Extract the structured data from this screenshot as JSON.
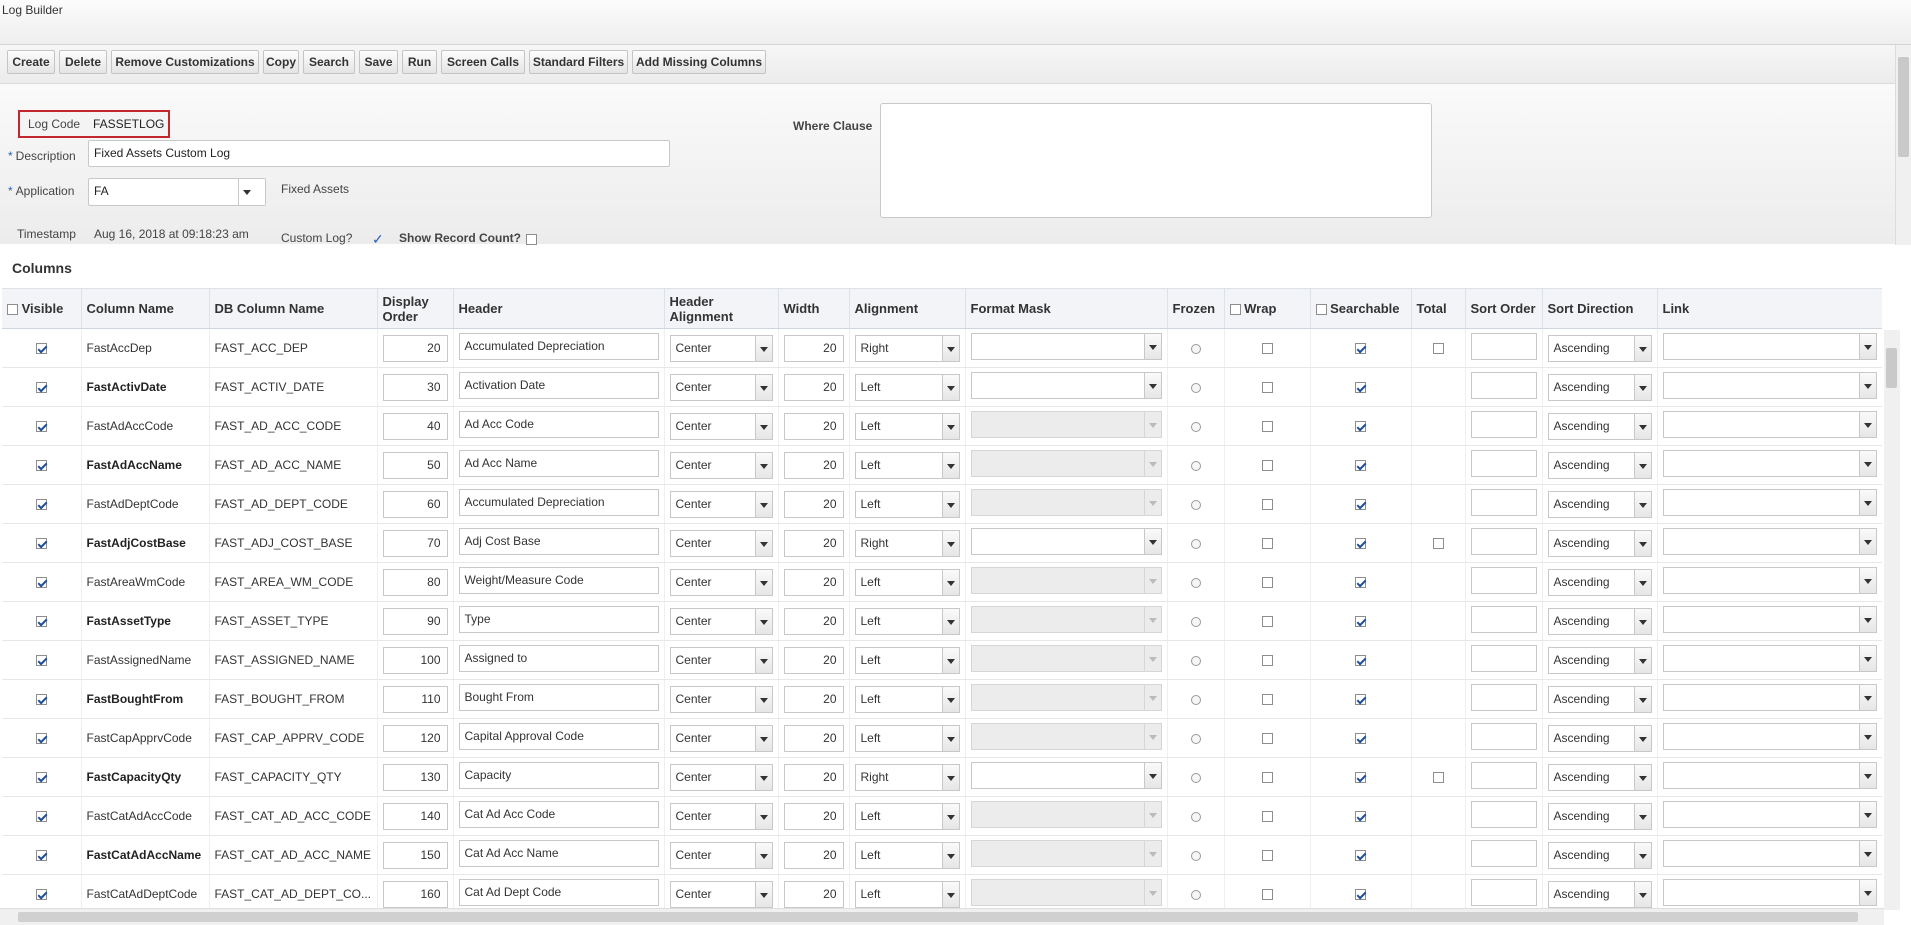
{
  "window": {
    "title": "Log Builder"
  },
  "toolbar": {
    "buttons": [
      "Create",
      "Delete",
      "Remove Customizations",
      "Copy",
      "Search",
      "Save",
      "Run",
      "Screen Calls",
      "Standard Filters",
      "Add Missing Columns"
    ]
  },
  "form": {
    "log_code_label": "Log Code",
    "log_code_value": "FASSETLOG",
    "description_label": "Description",
    "description_value": "Fixed Assets Custom Log",
    "application_label": "Application",
    "application_value": "FA",
    "application_name": "Fixed Assets",
    "timestamp_label": "Timestamp",
    "timestamp_value": "Aug 16, 2018 at 09:18:23 am",
    "custom_log_label": "Custom Log?",
    "custom_log_checked": true,
    "show_record_count_label": "Show Record Count?",
    "show_record_count_checked": false,
    "where_clause_label": "Where Clause",
    "where_clause_value": "",
    "required_marker": "*"
  },
  "columns_section": {
    "title": "Columns"
  },
  "table": {
    "headers": {
      "visible": "Visible",
      "column_name": "Column Name",
      "db_column_name": "DB Column Name",
      "display_order": "Display Order",
      "header": "Header",
      "header_alignment": "Header Alignment",
      "width": "Width",
      "alignment": "Alignment",
      "format_mask": "Format Mask",
      "frozen": "Frozen",
      "wrap": "Wrap",
      "searchable": "Searchable",
      "total": "Total",
      "sort_order": "Sort Order",
      "sort_direction": "Sort Direction",
      "link": "Link"
    },
    "rows": [
      {
        "column_name": "FastAccDep",
        "db_column_name": "FAST_ACC_DEP",
        "display_order": "20",
        "header": "Accumulated Depreciation",
        "header_alignment": "Center",
        "width": "20",
        "alignment": "Right",
        "format_mask_enabled": true,
        "total_visible": true,
        "sort_direction": "Ascending"
      },
      {
        "column_name": "FastActivDate",
        "db_column_name": "FAST_ACTIV_DATE",
        "display_order": "30",
        "header": "Activation Date",
        "header_alignment": "Center",
        "width": "20",
        "alignment": "Left",
        "format_mask_enabled": true,
        "total_visible": false,
        "sort_direction": "Ascending"
      },
      {
        "column_name": "FastAdAccCode",
        "db_column_name": "FAST_AD_ACC_CODE",
        "display_order": "40",
        "header": "Ad Acc Code",
        "header_alignment": "Center",
        "width": "20",
        "alignment": "Left",
        "format_mask_enabled": false,
        "total_visible": false,
        "sort_direction": "Ascending"
      },
      {
        "column_name": "FastAdAccName",
        "db_column_name": "FAST_AD_ACC_NAME",
        "display_order": "50",
        "header": "Ad Acc Name",
        "header_alignment": "Center",
        "width": "20",
        "alignment": "Left",
        "format_mask_enabled": false,
        "total_visible": false,
        "sort_direction": "Ascending"
      },
      {
        "column_name": "FastAdDeptCode",
        "db_column_name": "FAST_AD_DEPT_CODE",
        "display_order": "60",
        "header": "Accumulated Depreciation",
        "header_alignment": "Center",
        "width": "20",
        "alignment": "Left",
        "format_mask_enabled": false,
        "total_visible": false,
        "sort_direction": "Ascending"
      },
      {
        "column_name": "FastAdjCostBase",
        "db_column_name": "FAST_ADJ_COST_BASE",
        "display_order": "70",
        "header": "Adj Cost Base",
        "header_alignment": "Center",
        "width": "20",
        "alignment": "Right",
        "format_mask_enabled": true,
        "total_visible": true,
        "sort_direction": "Ascending"
      },
      {
        "column_name": "FastAreaWmCode",
        "db_column_name": "FAST_AREA_WM_CODE",
        "display_order": "80",
        "header": "Weight/Measure Code",
        "header_alignment": "Center",
        "width": "20",
        "alignment": "Left",
        "format_mask_enabled": false,
        "total_visible": false,
        "sort_direction": "Ascending"
      },
      {
        "column_name": "FastAssetType",
        "db_column_name": "FAST_ASSET_TYPE",
        "display_order": "90",
        "header": "Type",
        "header_alignment": "Center",
        "width": "20",
        "alignment": "Left",
        "format_mask_enabled": false,
        "total_visible": false,
        "sort_direction": "Ascending"
      },
      {
        "column_name": "FastAssignedName",
        "db_column_name": "FAST_ASSIGNED_NAME",
        "display_order": "100",
        "header": "Assigned to",
        "header_alignment": "Center",
        "width": "20",
        "alignment": "Left",
        "format_mask_enabled": false,
        "total_visible": false,
        "sort_direction": "Ascending"
      },
      {
        "column_name": "FastBoughtFrom",
        "db_column_name": "FAST_BOUGHT_FROM",
        "display_order": "110",
        "header": "Bought From",
        "header_alignment": "Center",
        "width": "20",
        "alignment": "Left",
        "format_mask_enabled": false,
        "total_visible": false,
        "sort_direction": "Ascending"
      },
      {
        "column_name": "FastCapApprvCode",
        "db_column_name": "FAST_CAP_APPRV_CODE",
        "display_order": "120",
        "header": "Capital Approval Code",
        "header_alignment": "Center",
        "width": "20",
        "alignment": "Left",
        "format_mask_enabled": false,
        "total_visible": false,
        "sort_direction": "Ascending"
      },
      {
        "column_name": "FastCapacityQty",
        "db_column_name": "FAST_CAPACITY_QTY",
        "display_order": "130",
        "header": "Capacity",
        "header_alignment": "Center",
        "width": "20",
        "alignment": "Right",
        "format_mask_enabled": true,
        "total_visible": true,
        "sort_direction": "Ascending"
      },
      {
        "column_name": "FastCatAdAccCode",
        "db_column_name": "FAST_CAT_AD_ACC_CODE",
        "display_order": "140",
        "header": "Cat Ad Acc Code",
        "header_alignment": "Center",
        "width": "20",
        "alignment": "Left",
        "format_mask_enabled": false,
        "total_visible": false,
        "sort_direction": "Ascending"
      },
      {
        "column_name": "FastCatAdAccName",
        "db_column_name": "FAST_CAT_AD_ACC_NAME",
        "display_order": "150",
        "header": "Cat Ad Acc Name",
        "header_alignment": "Center",
        "width": "20",
        "alignment": "Left",
        "format_mask_enabled": false,
        "total_visible": false,
        "sort_direction": "Ascending"
      },
      {
        "column_name": "FastCatAdDeptCode",
        "db_column_name": "FAST_CAT_AD_DEPT_CO...",
        "display_order": "160",
        "header": "Cat Ad Dept Code",
        "header_alignment": "Center",
        "width": "20",
        "alignment": "Left",
        "format_mask_enabled": false,
        "total_visible": false,
        "sort_direction": "Ascending"
      }
    ]
  }
}
